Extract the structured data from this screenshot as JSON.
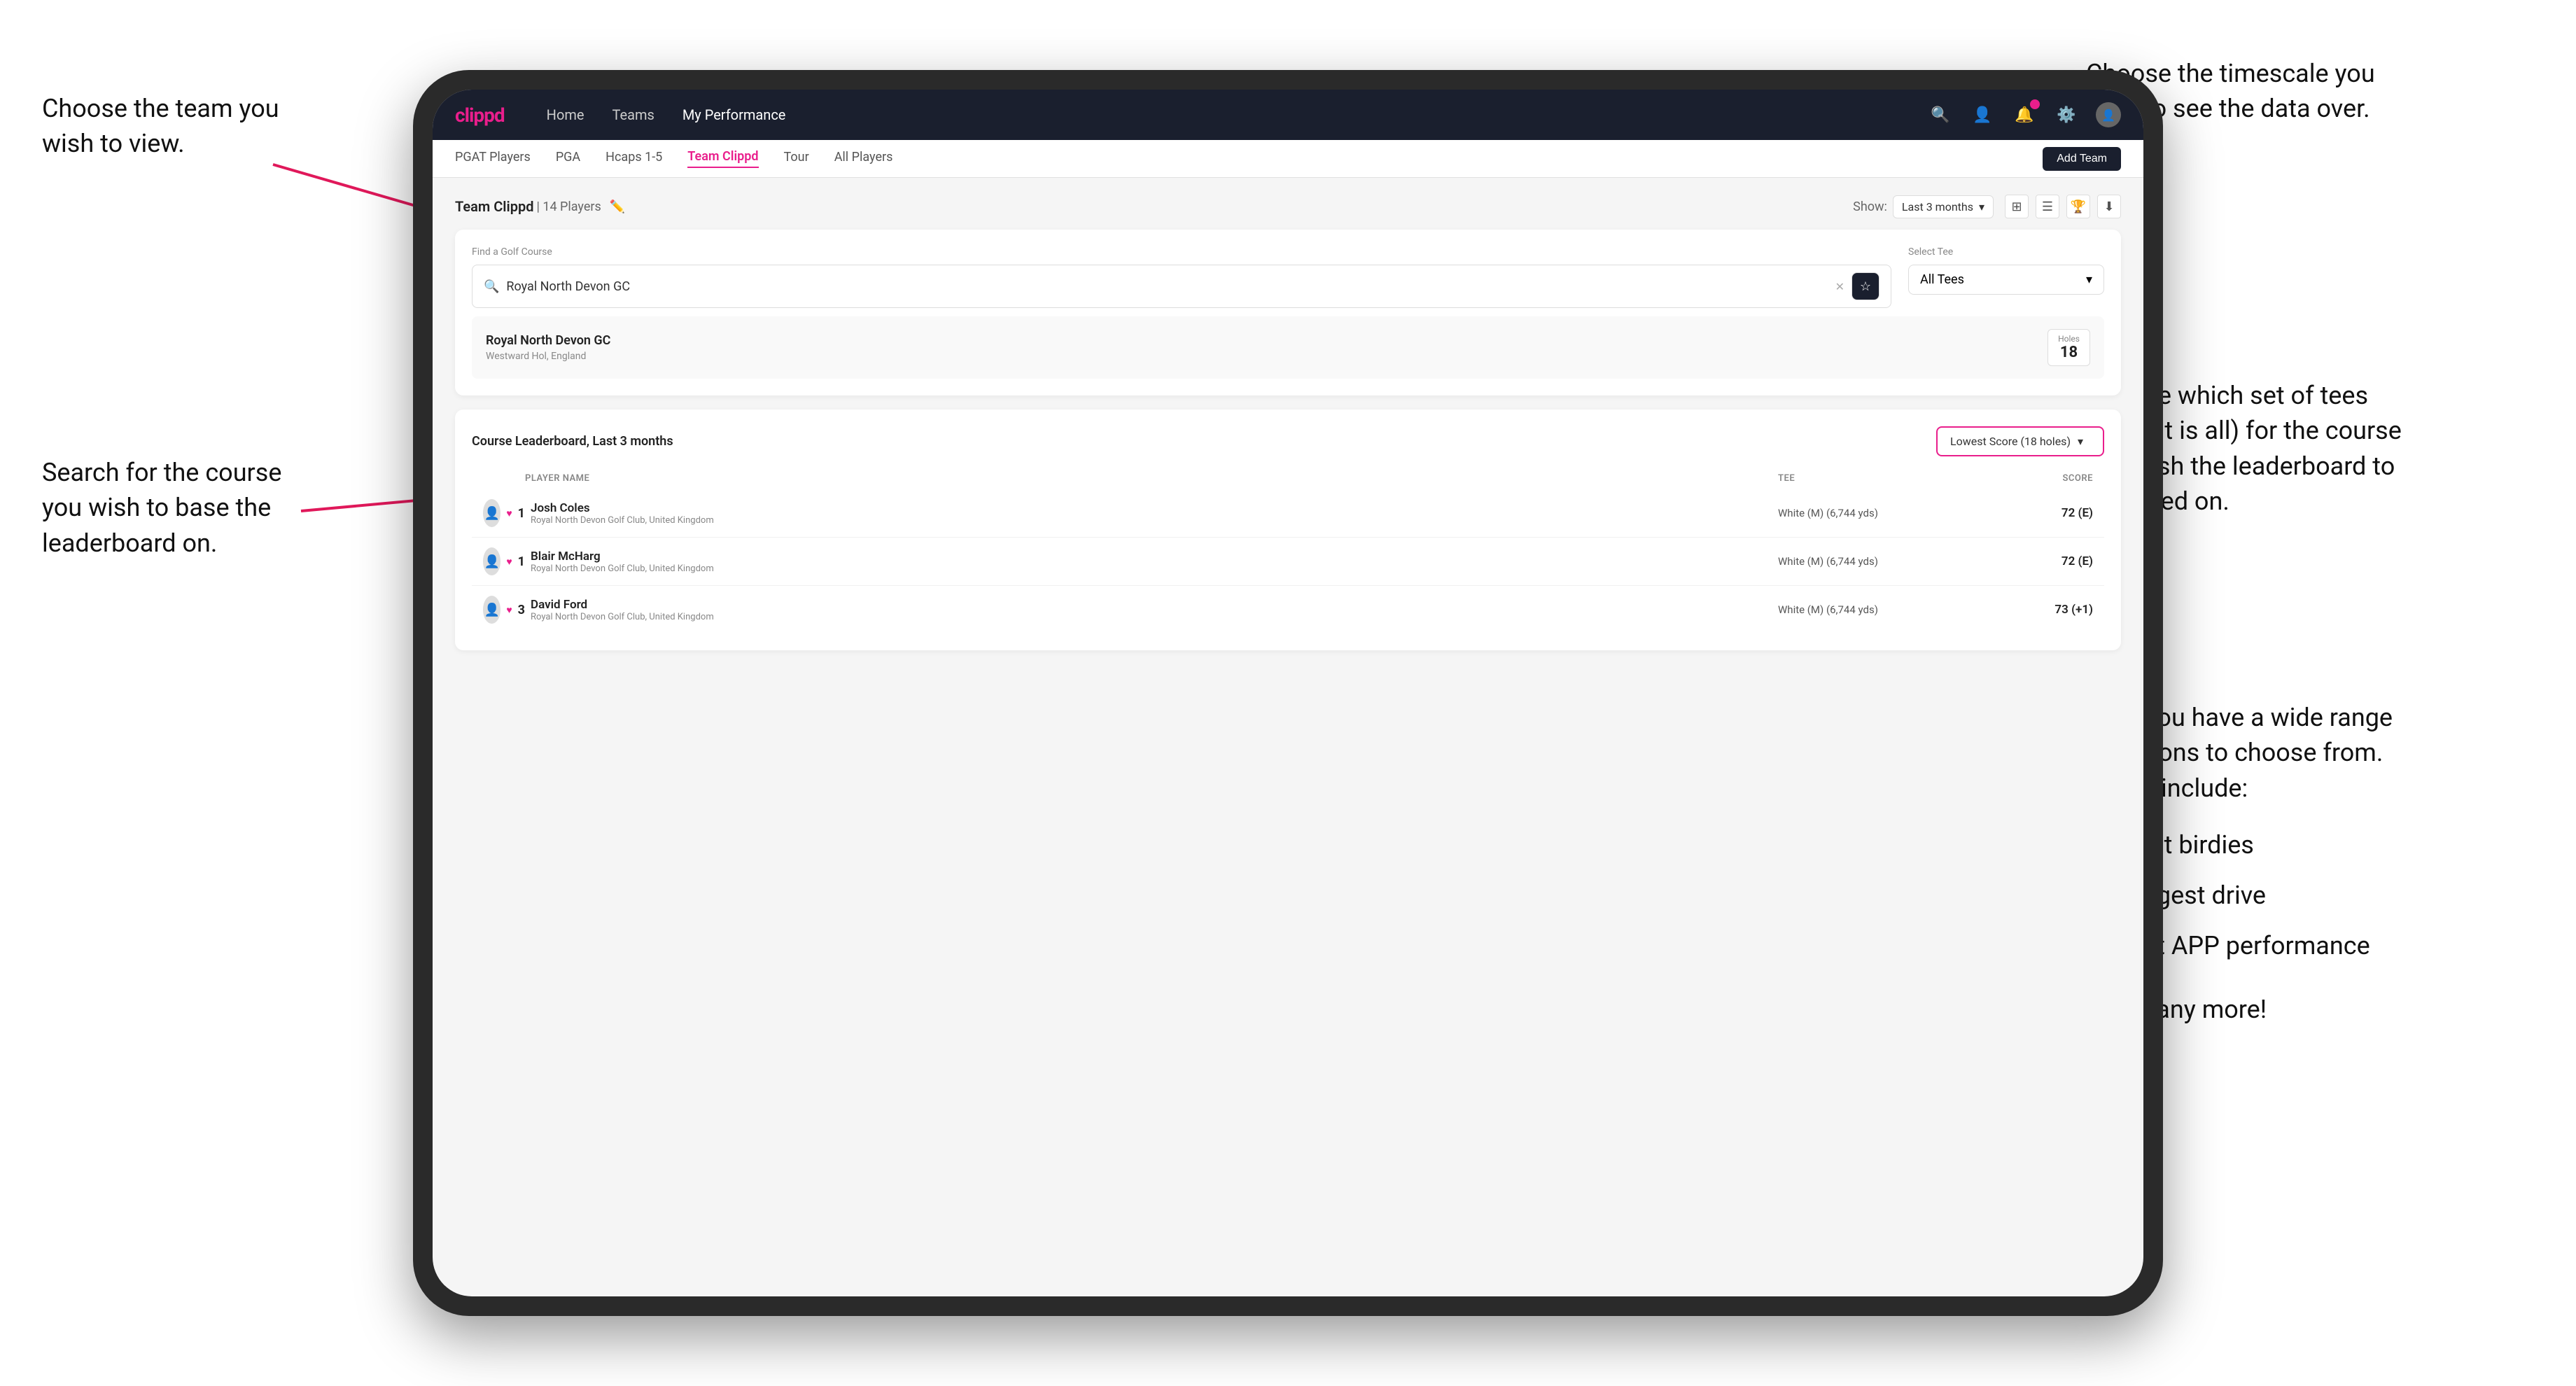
{
  "annotations": {
    "top_left_title": "Choose the team you\nwish to view.",
    "mid_left_title": "Search for the course\nyou wish to base the\nleaderboard on.",
    "top_right_title": "Choose the timescale you\nwish to see the data over.",
    "mid_right_title": "Choose which set of tees\n(default is all) for the course\nyou wish the leaderboard to\nbe based on.",
    "bottom_right_title": "Here you have a wide range\nof options to choose from.\nThese include:",
    "bullets": [
      "Most birdies",
      "Longest drive",
      "Best APP performance"
    ],
    "and_more": "and many more!"
  },
  "navbar": {
    "logo": "clippd",
    "links": [
      "Home",
      "Teams",
      "My Performance"
    ],
    "active_link": "My Performance"
  },
  "subnav": {
    "links": [
      "PGAT Players",
      "PGA",
      "Hcaps 1-5",
      "Team Clippd",
      "Tour",
      "All Players"
    ],
    "active_link": "Team Clippd",
    "add_team_label": "Add Team"
  },
  "team_section": {
    "title": "Team Clippd",
    "count": "14 Players",
    "show_label": "Show:",
    "timescale": "Last 3 months"
  },
  "course_search": {
    "find_label": "Find a Golf Course",
    "search_value": "Royal North Devon GC",
    "select_tee_label": "Select Tee",
    "tee_value": "All Tees",
    "course_name": "Royal North Devon GC",
    "course_location": "Westward Hol, England",
    "holes_label": "Holes",
    "holes_value": "18"
  },
  "leaderboard": {
    "title": "Course Leaderboard,",
    "timescale": "Last 3 months",
    "score_filter": "Lowest Score (18 holes)",
    "columns": [
      "PLAYER NAME",
      "TEE",
      "SCORE"
    ],
    "players": [
      {
        "rank": "1",
        "name": "Josh Coles",
        "club": "Royal North Devon Golf Club, United Kingdom",
        "tee": "White (M) (6,744 yds)",
        "score": "72 (E)"
      },
      {
        "rank": "1",
        "name": "Blair McHarg",
        "club": "Royal North Devon Golf Club, United Kingdom",
        "tee": "White (M) (6,744 yds)",
        "score": "72 (E)"
      },
      {
        "rank": "3",
        "name": "David Ford",
        "club": "Royal North Devon Golf Club, United Kingdom",
        "tee": "White (M) (6,744 yds)",
        "score": "73 (+1)"
      }
    ]
  }
}
